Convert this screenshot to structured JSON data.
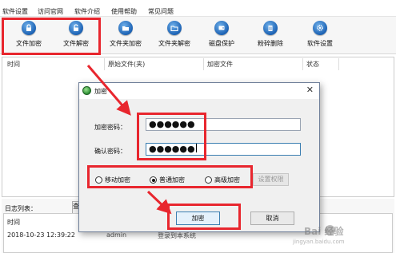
{
  "menubar": {
    "items": [
      "软件设置",
      "访问官网",
      "软件介绍",
      "使用帮助",
      "常见问题"
    ]
  },
  "toolbar": {
    "buttons": [
      {
        "label": "文件加密",
        "icon": "lock-icon"
      },
      {
        "label": "文件解密",
        "icon": "unlock-icon"
      },
      {
        "label": "文件夹加密",
        "icon": "folder-lock-icon"
      },
      {
        "label": "文件夹解密",
        "icon": "folder-unlock-icon"
      },
      {
        "label": "磁盘保护",
        "icon": "disk-icon"
      },
      {
        "label": "粉碎删除",
        "icon": "shred-icon"
      },
      {
        "label": "软件设置",
        "icon": "gear-icon"
      }
    ]
  },
  "file_table": {
    "columns": [
      "时间",
      "原始文件(夹)",
      "加密文件",
      "状态"
    ]
  },
  "log": {
    "label": "日志列表：",
    "button_text": "查",
    "header": "时间",
    "row_time": "2018-10-23 12:39:22",
    "row_user": "admin",
    "row_msg": "登录到本系统"
  },
  "dialog": {
    "title": "加密",
    "close_glyph": "✕",
    "password_label": "加密密码：",
    "password_value": "●●●●●●",
    "confirm_label": "确认密码：",
    "confirm_value": "●●●●●●",
    "modes": [
      {
        "label": "移动加密",
        "checked": false
      },
      {
        "label": "普通加密",
        "checked": true
      },
      {
        "label": "高级加密",
        "checked": false
      }
    ],
    "permission_button": "设置权限",
    "ok_button": "加密",
    "cancel_button": "取消"
  },
  "watermark": {
    "line1": "Bai 经验",
    "line2": "jingyan.baidu.com"
  },
  "colors": {
    "highlight": "#e8262e",
    "toolbar_icon": "#1c62b4",
    "dialog_border": "#6f7f99"
  }
}
